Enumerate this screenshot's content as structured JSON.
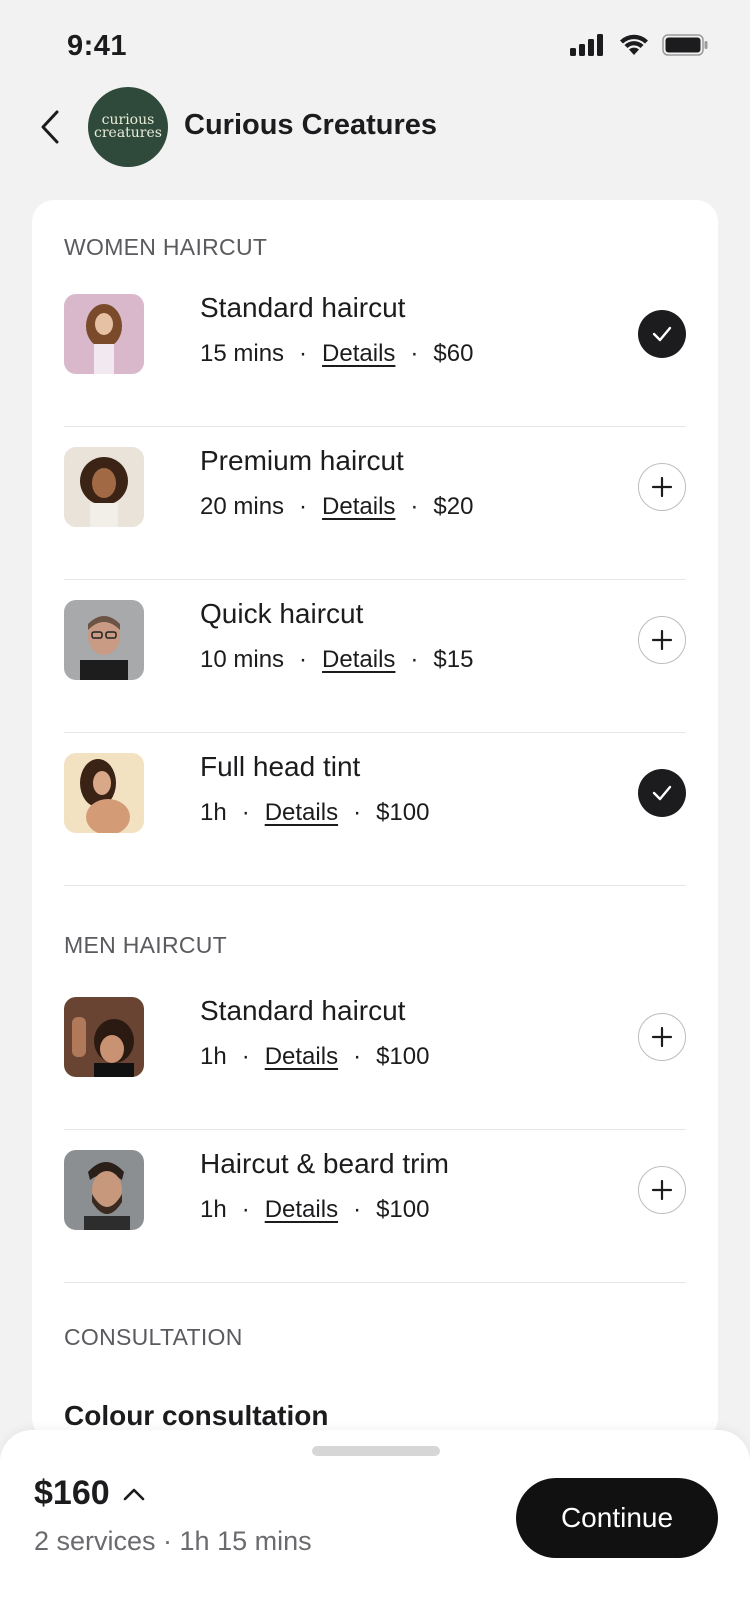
{
  "status": {
    "time": "9:41"
  },
  "header": {
    "title": "Curious Creatures",
    "logo_line1": "curious",
    "logo_line2": "creatures"
  },
  "sections": [
    {
      "title": "WOMEN HAIRCUT",
      "services": [
        {
          "name": "Standard haircut",
          "duration": "15 mins",
          "details_label": "Details",
          "price": "$60",
          "selected": true
        },
        {
          "name": "Premium haircut",
          "duration": "20 mins",
          "details_label": "Details",
          "price": "$20",
          "selected": false
        },
        {
          "name": "Quick haircut",
          "duration": "10 mins",
          "details_label": "Details",
          "price": "$15",
          "selected": false
        },
        {
          "name": "Full head tint",
          "duration": "1h",
          "details_label": "Details",
          "price": "$100",
          "selected": true
        }
      ]
    },
    {
      "title": "MEN HAIRCUT",
      "services": [
        {
          "name": "Standard haircut",
          "duration": "1h",
          "details_label": "Details",
          "price": "$100",
          "selected": false
        },
        {
          "name": "Haircut & beard trim",
          "duration": "1h",
          "details_label": "Details",
          "price": "$100",
          "selected": false
        }
      ]
    },
    {
      "title": "CONSULTATION",
      "services": []
    }
  ],
  "peek_text": "Colour consultation",
  "bottom": {
    "total": "$160",
    "summary": "2 services · 1h 15 mins",
    "continue_label": "Continue"
  },
  "colors": {
    "accent": "#111111",
    "logo_bg": "#2f4a3b",
    "background": "#f2f2f2"
  }
}
